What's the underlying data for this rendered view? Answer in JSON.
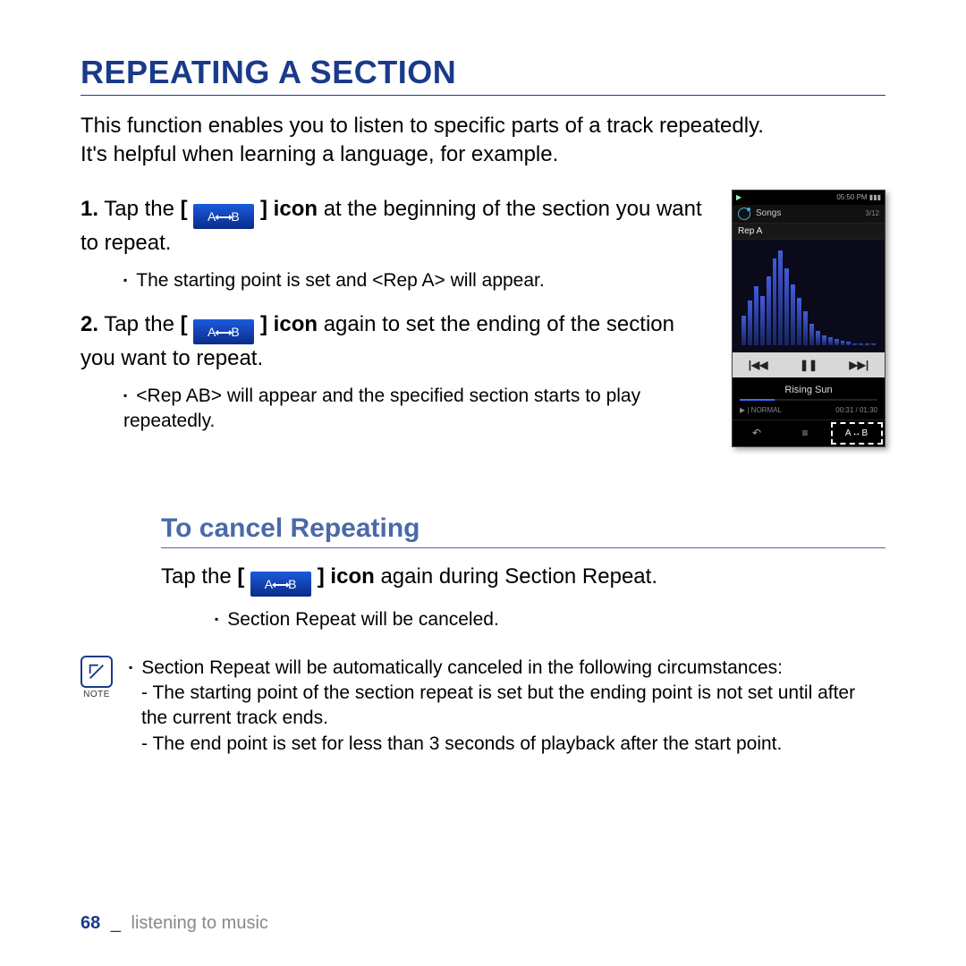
{
  "heading": "REPEATING A SECTION",
  "intro": {
    "line1": "This function enables you to listen to specific parts of a track repeatedly.",
    "line2": "It's helpful when learning a language, for example."
  },
  "ab_label": {
    "a": "A",
    "b": "B"
  },
  "steps": [
    {
      "num": "1.",
      "pre": "Tap the",
      "bracket_open": "[",
      "bracket_close": "]",
      "icon_word": "icon",
      "post": "at the beginning of the section you want to repeat.",
      "sub": "The starting point is set and <Rep A> will appear."
    },
    {
      "num": "2.",
      "pre": "Tap the",
      "bracket_open": "[",
      "bracket_close": "]",
      "icon_word": "icon",
      "post": "again to set the ending of the section you want to repeat.",
      "sub": "<Rep AB> will appear and the specified section starts to play repeatedly."
    }
  ],
  "device": {
    "status_left": "▶",
    "status_right": "05:50 PM ▮▮▮",
    "title": "Songs",
    "counter": "3/12",
    "rep": "Rep A",
    "eq_heights": [
      30,
      45,
      60,
      50,
      70,
      88,
      96,
      78,
      62,
      48,
      34,
      22,
      14,
      10,
      8,
      6,
      4,
      3,
      2,
      2,
      2,
      2
    ],
    "ctrl_prev": "|◀◀",
    "ctrl_play": "❚❚",
    "ctrl_next": "▶▶|",
    "track": "Rising Sun",
    "mode": "▶ | NORMAL",
    "time": "00:31 / 01:30",
    "bot_back": "↶",
    "bot_menu": "≡",
    "bot_ab": "A↔B"
  },
  "cancel": {
    "heading": "To cancel Repeating",
    "pre": "Tap the",
    "bracket_open": "[",
    "bracket_close": "]",
    "icon_word": "icon",
    "post": "again during Section Repeat.",
    "sub": "Section Repeat will be canceled."
  },
  "note": {
    "label": "NOTE",
    "lead": "Section Repeat will be automatically canceled in the following circumstances:",
    "dash1": "- The starting point of the section repeat is set but the ending point is not set until after the current track ends.",
    "dash2": "- The end point is set for less than 3 seconds of playback after the start point."
  },
  "footer": {
    "page": "68",
    "sep": "_",
    "chapter": "listening to music"
  }
}
